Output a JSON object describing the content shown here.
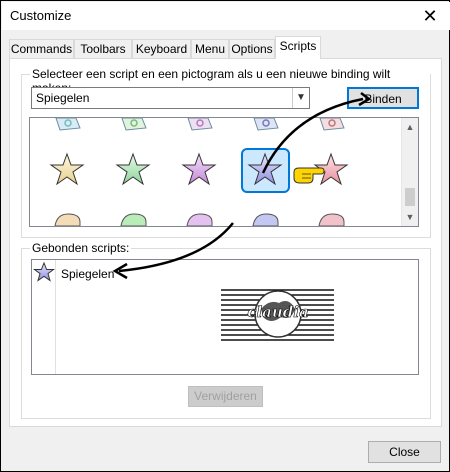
{
  "window": {
    "title": "Customize",
    "close_glyph": "✕"
  },
  "tabs": [
    {
      "label": "Commands",
      "active": false
    },
    {
      "label": "Toolbars",
      "active": false
    },
    {
      "label": "Keyboard",
      "active": false
    },
    {
      "label": "Menu",
      "active": false
    },
    {
      "label": "Options",
      "active": false
    },
    {
      "label": "Scripts",
      "active": true
    }
  ],
  "select_group": {
    "label": "Selecteer een script en een pictogram als u een nieuwe binding wilt maken:",
    "script_combo_value": "Spiegelen",
    "bind_button": "Binden"
  },
  "icon_grid": {
    "rows": [
      {
        "icons": [
          "document-icon-blue",
          "document-icon-green",
          "document-icon-purple",
          "document-icon-blue"
        ]
      },
      {
        "icons": [
          "star-icon-yellow",
          "star-icon-green",
          "star-icon-purple",
          "star-icon-blue-selected",
          "star-icon-pink"
        ]
      },
      {
        "icons": [
          "pointing-hand-icon"
        ]
      },
      {
        "icons": [
          "blob-icon-orange",
          "blob-icon-green",
          "blob-icon-purple",
          "blob-icon-blue",
          "blob-icon-pink"
        ]
      }
    ],
    "selected": "star-icon-blue"
  },
  "bound_group": {
    "label": "Gebonden scripts:",
    "items": [
      {
        "icon": "star-icon-blue",
        "label": "Spiegelen"
      }
    ],
    "remove_button": "Verwijderen",
    "watermark_logo_text": "claudia"
  },
  "footer": {
    "close_button": "Close"
  },
  "colors": {
    "selection_border": "#0078d7",
    "selection_fill": "#cce8ff",
    "arrow": "#000000"
  }
}
